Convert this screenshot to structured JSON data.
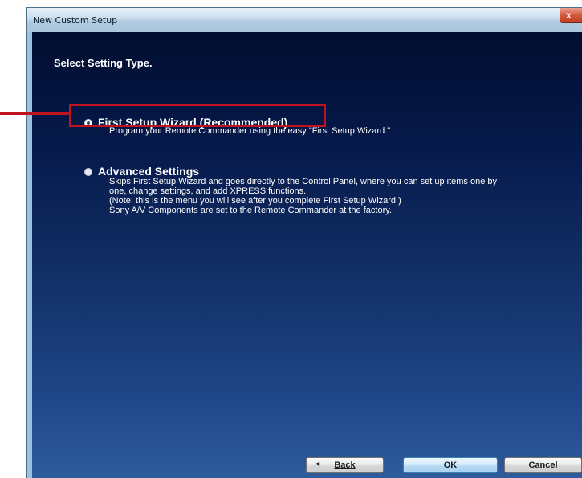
{
  "window": {
    "title": "New Custom Setup",
    "close_glyph": "x"
  },
  "page": {
    "heading": "Select Setting Type."
  },
  "options": [
    {
      "label": "First Setup Wizard (Recommended)",
      "selected": true,
      "description": [
        "Program your Remote Commander using the easy \"First Setup Wizard.\""
      ]
    },
    {
      "label": "Advanced Settings",
      "selected": false,
      "description": [
        "Skips First Setup Wizard and goes directly to the Control Panel, where you can set up items one by",
        "one, change settings, and add XPRESS functions.",
        "(Note: this is the menu you will see after you complete First Setup Wizard.)",
        "Sony A/V Components are set to the Remote Commander at the factory."
      ]
    }
  ],
  "buttons": {
    "back_arrow": "◄",
    "back": "Back",
    "ok": "OK",
    "cancel": "Cancel"
  },
  "annotation": {
    "color": "#c1121f"
  }
}
